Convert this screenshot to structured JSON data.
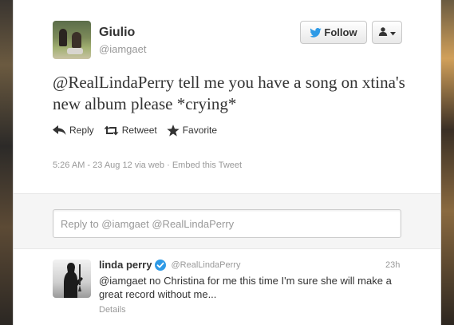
{
  "tweet": {
    "author_name": "Giulio",
    "author_handle": "@iamgaet",
    "follow_label": "Follow",
    "text": "@RealLindaPerry tell me you have a song on xtina's new album please *crying*",
    "actions": {
      "reply": "Reply",
      "retweet": "Retweet",
      "favorite": "Favorite"
    },
    "timestamp": "5:26 AM - 23 Aug 12 via web",
    "embed_link": "Embed this Tweet"
  },
  "reply_input": {
    "placeholder": "Reply to @iamgaet @RealLindaPerry"
  },
  "reply_tweet": {
    "author_name": "linda perry",
    "author_handle": "@RealLindaPerry",
    "time": "23h",
    "text": "@iamgaet no Christina for me this time I'm sure she will make a great record without me...",
    "details_label": "Details"
  },
  "colors": {
    "twitter_blue": "#2e9ae6",
    "text_dark": "#333333",
    "text_muted": "#999999"
  },
  "icons": {
    "follow": "bird-icon",
    "user_menu": "user-dropdown-icon",
    "reply": "reply-arrow-icon",
    "retweet": "retweet-icon",
    "favorite": "star-icon",
    "verified": "verified-badge-icon"
  }
}
